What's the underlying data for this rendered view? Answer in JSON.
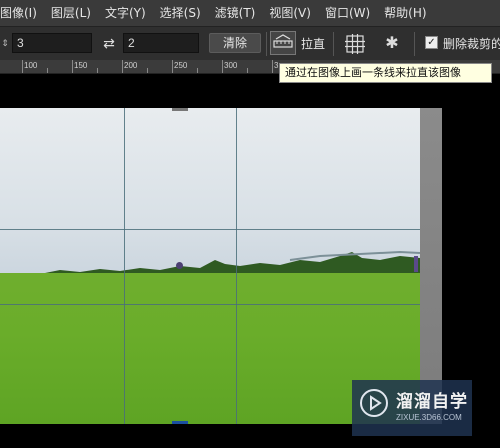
{
  "menubar": {
    "items": [
      "图像(I)",
      "图层(L)",
      "文字(Y)",
      "选择(S)",
      "滤镜(T)",
      "视图(V)",
      "窗口(W)",
      "帮助(H)"
    ]
  },
  "options": {
    "width_value": "3",
    "height_value": "2",
    "clear_label": "清除",
    "straighten_label": "拉直",
    "delete_cropped_label": "删除裁剪的",
    "delete_cropped_checked": true
  },
  "ruler": {
    "labels": [
      "100",
      "150",
      "200",
      "250",
      "300",
      "3"
    ]
  },
  "tooltip": {
    "text": "通过在图像上画一条线来拉直该图像"
  },
  "watermark": {
    "title": "溜溜自学",
    "url": "ZIXUE.3D66.COM"
  },
  "icons": {
    "swap": "swap-arrows-icon",
    "straighten": "straighten-ruler-icon",
    "grid": "grid-overlay-icon",
    "gear": "gear-icon",
    "watermark_logo": "play-logo-icon"
  }
}
